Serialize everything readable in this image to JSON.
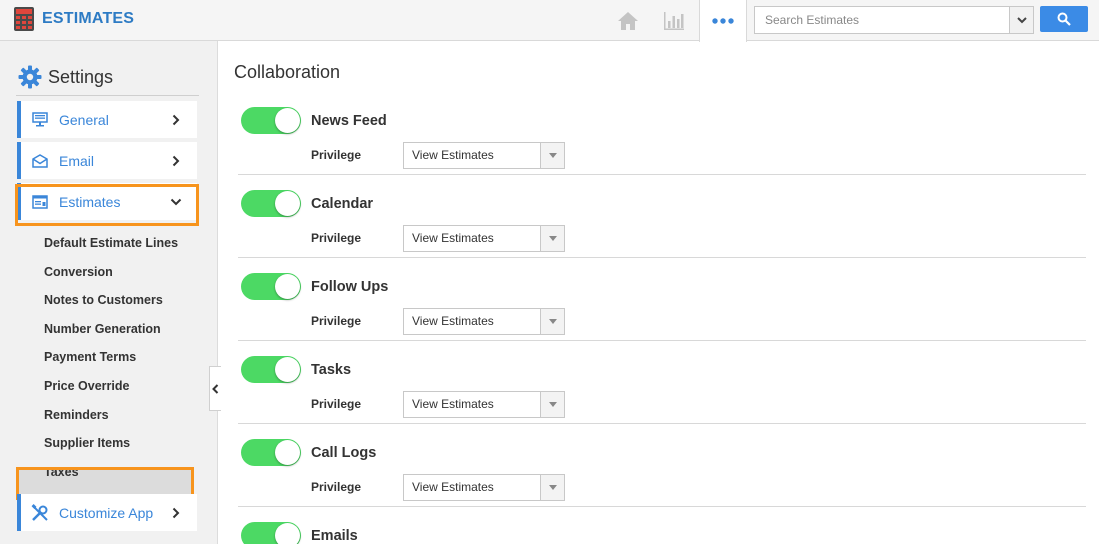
{
  "app": {
    "title": "ESTIMATES",
    "accent": "#2d7bc4"
  },
  "search": {
    "placeholder": "Search Estimates"
  },
  "sidebar": {
    "heading": "Settings",
    "items": [
      {
        "label": "General",
        "icon": "monitor-icon"
      },
      {
        "label": "Email",
        "icon": "envelope-icon"
      },
      {
        "label": "Estimates",
        "icon": "estimate-form-icon"
      }
    ],
    "subitems": [
      "Default Estimate Lines",
      "Conversion",
      "Notes to Customers",
      "Number Generation",
      "Payment Terms",
      "Price Override",
      "Reminders",
      "Supplier Items",
      "Taxes"
    ],
    "active_subitem": "Supplier Items",
    "customize": {
      "label": "Customize App",
      "icon": "wrench-screwdriver-icon"
    }
  },
  "main": {
    "title": "Collaboration",
    "privilege_label": "Privilege",
    "toggle_color": "#4cd964",
    "rows": [
      {
        "name": "News Feed",
        "enabled": true,
        "privilege": "View Estimates"
      },
      {
        "name": "Calendar",
        "enabled": true,
        "privilege": "View Estimates"
      },
      {
        "name": "Follow Ups",
        "enabled": true,
        "privilege": "View Estimates"
      },
      {
        "name": "Tasks",
        "enabled": true,
        "privilege": "View Estimates"
      },
      {
        "name": "Call Logs",
        "enabled": true,
        "privilege": "View Estimates"
      },
      {
        "name": "Emails",
        "enabled": true
      }
    ]
  }
}
